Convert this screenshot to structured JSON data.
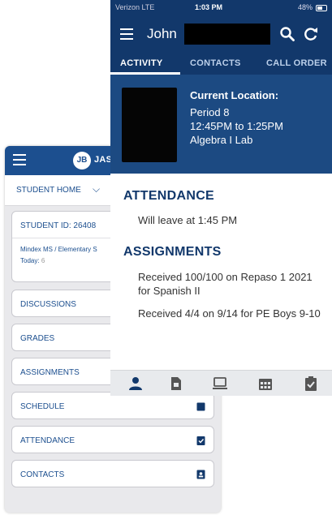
{
  "back_app": {
    "header": {
      "avatar_initials": "JB",
      "user_label": "JASC"
    },
    "nav": {
      "label": "STUDENT HOME"
    },
    "student_card": {
      "id_label": "STUDENT ID: 26408",
      "school": "Mindex MS / Elementary S",
      "today_label": "Today:",
      "today_count": "6"
    },
    "menu": [
      {
        "label": "DISCUSSIONS",
        "icon": "chat-icon"
      },
      {
        "label": "GRADES",
        "icon": "grades-icon"
      },
      {
        "label": "ASSIGNMENTS",
        "icon": "assignments-icon"
      },
      {
        "label": "SCHEDULE",
        "icon": "calendar-icon"
      },
      {
        "label": "ATTENDANCE",
        "icon": "clipboard-check-icon"
      },
      {
        "label": "CONTACTS",
        "icon": "contact-card-icon"
      }
    ]
  },
  "front_app": {
    "status_bar": {
      "carrier": "Verizon LTE",
      "time": "1:03 PM",
      "battery": "48%"
    },
    "title": "John",
    "tabs": [
      "ACTIVITY",
      "CONTACTS",
      "CALL ORDER"
    ],
    "location": {
      "heading": "Current Location:",
      "period": "Period 8",
      "time": "12:45PM to 1:25PM",
      "class": "Algebra I Lab"
    },
    "attendance": {
      "title": "ATTENDANCE",
      "entry": "Will leave at 1:45 PM"
    },
    "assignments": {
      "title": "ASSIGNMENTS",
      "entries": [
        "Received 100/100 on Repaso 1 2021  for Spanish II",
        "Received 4/4 on 9/14 for PE Boys 9-10"
      ]
    },
    "bottom_nav": [
      "person-icon",
      "report-card-icon",
      "computer-icon",
      "calendar-icon",
      "clipboard-check-icon"
    ]
  },
  "colors": {
    "navy": "#12386b",
    "panel_blue": "#1c4a82",
    "link_blue": "#1c4f8f",
    "nav_bg": "#e8eaed"
  }
}
